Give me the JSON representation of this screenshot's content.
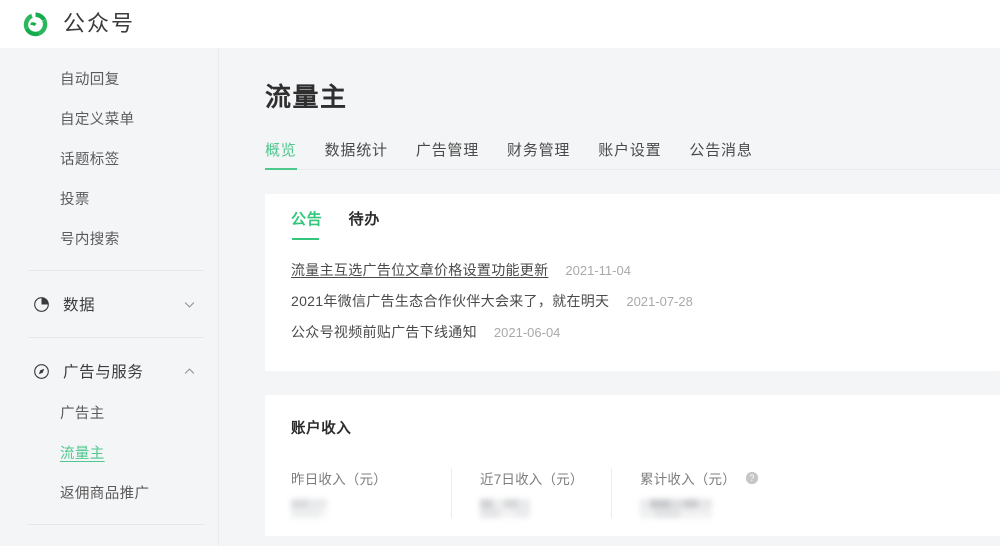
{
  "brand": {
    "logo_icon": "wechat-official-account-logo",
    "name": "公众号"
  },
  "sidebar": {
    "top_items": [
      {
        "label": "自动回复",
        "active": false
      },
      {
        "label": "自定义菜单",
        "active": false
      },
      {
        "label": "话题标签",
        "active": false
      },
      {
        "label": "投票",
        "active": false
      },
      {
        "label": "号内搜索",
        "active": false
      }
    ],
    "groups": [
      {
        "label": "数据",
        "icon": "pie-chart-icon",
        "chevron": "chevron-down-icon",
        "expanded": false,
        "children": []
      },
      {
        "label": "广告与服务",
        "icon": "compass-icon",
        "chevron": "chevron-up-icon",
        "expanded": true,
        "children": [
          {
            "label": "广告主",
            "active": false
          },
          {
            "label": "流量主",
            "active": true
          },
          {
            "label": "返佣商品推广",
            "active": false
          }
        ]
      }
    ]
  },
  "main": {
    "page_title": "流量主",
    "tabs": [
      {
        "label": "概览",
        "active": true
      },
      {
        "label": "数据统计",
        "active": false
      },
      {
        "label": "广告管理",
        "active": false
      },
      {
        "label": "财务管理",
        "active": false
      },
      {
        "label": "账户设置",
        "active": false
      },
      {
        "label": "公告消息",
        "active": false
      }
    ],
    "notice_card": {
      "tabs": [
        {
          "label": "公告",
          "active": true
        },
        {
          "label": "待办",
          "active": false
        }
      ],
      "notices": [
        {
          "title": "流量主互选广告位文章价格设置功能更新",
          "date": "2021-11-04"
        },
        {
          "title": "2021年微信广告生态合作伙伴大会来了，就在明天",
          "date": "2021-07-28"
        },
        {
          "title": "公众号视频前贴广告下线通知",
          "date": "2021-06-04"
        }
      ]
    },
    "income_card": {
      "heading": "账户收入",
      "stats": [
        {
          "label": "昨日收入（元）",
          "value": "",
          "redacted": true,
          "help": false
        },
        {
          "label": "近7日收入（元）",
          "value": "",
          "redacted": true,
          "help": false
        },
        {
          "label": "累计收入（元）",
          "value": "",
          "redacted": true,
          "help": true,
          "help_icon": "help-circle-icon"
        }
      ]
    }
  },
  "colors": {
    "brand_green": "#1aad50",
    "accent_green": "#4ec88c",
    "page_bg": "#f4f5f7",
    "card_bg": "#ffffff",
    "text_primary": "#353535",
    "text_muted": "#a9a9a9"
  }
}
